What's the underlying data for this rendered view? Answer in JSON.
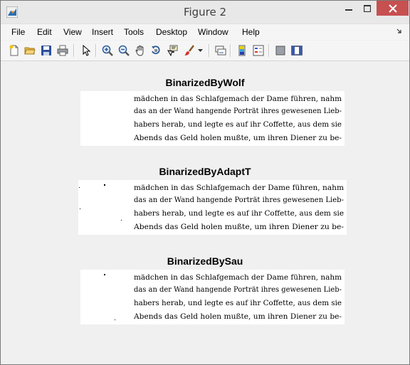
{
  "window": {
    "title": "Figure 2"
  },
  "menu": {
    "items": [
      "File",
      "Edit",
      "View",
      "Insert",
      "Tools",
      "Desktop",
      "Window",
      "Help"
    ]
  },
  "toolbar": {
    "buttons": [
      "new-figure-icon",
      "open-folder-icon",
      "save-icon",
      "print-icon",
      "select-arrow-icon",
      "zoom-in-icon",
      "zoom-out-icon",
      "pan-hand-icon",
      "rotate-3d-icon",
      "data-cursor-icon",
      "brush-icon",
      "link-plot-icon",
      "colorbar-icon",
      "legend-icon",
      "hide-plot-tools-icon",
      "show-plot-tools-icon"
    ]
  },
  "figures": [
    {
      "title": "BinarizedByWolf",
      "lines": [
        "mädchen in das Schlafgemach der Dame führen, nahm",
        "das an der Wand hangende Porträt ihres gewesenen Lieb-",
        "habers herab, und legte es auf ihr Coffette, aus dem sie",
        "Abends das Geld holen mußte, um ihren Diener zu be-"
      ]
    },
    {
      "title": "BinarizedByAdaptT",
      "lines": [
        "mädchen in das Schlafgemach der Dame führen, nahm",
        "das an der Wand hangende Porträt ihres gewesenen Lieb-",
        "habers herab, und legte es auf ihr Coffette, aus dem sie",
        "Abends das Geld holen mußte, um ihren Diener zu be-"
      ]
    },
    {
      "title": "BinarizedBySau",
      "lines": [
        "mädchen in das Schlafgemach der Dame führen, nahm",
        "das an der Wand hangende Porträt ihres gewesenen Lieb-",
        "habers herab, und legte es auf ihr Coffette, aus dem sie",
        "Abends das Geld holen mußte, um ihren Diener zu be-"
      ]
    }
  ]
}
